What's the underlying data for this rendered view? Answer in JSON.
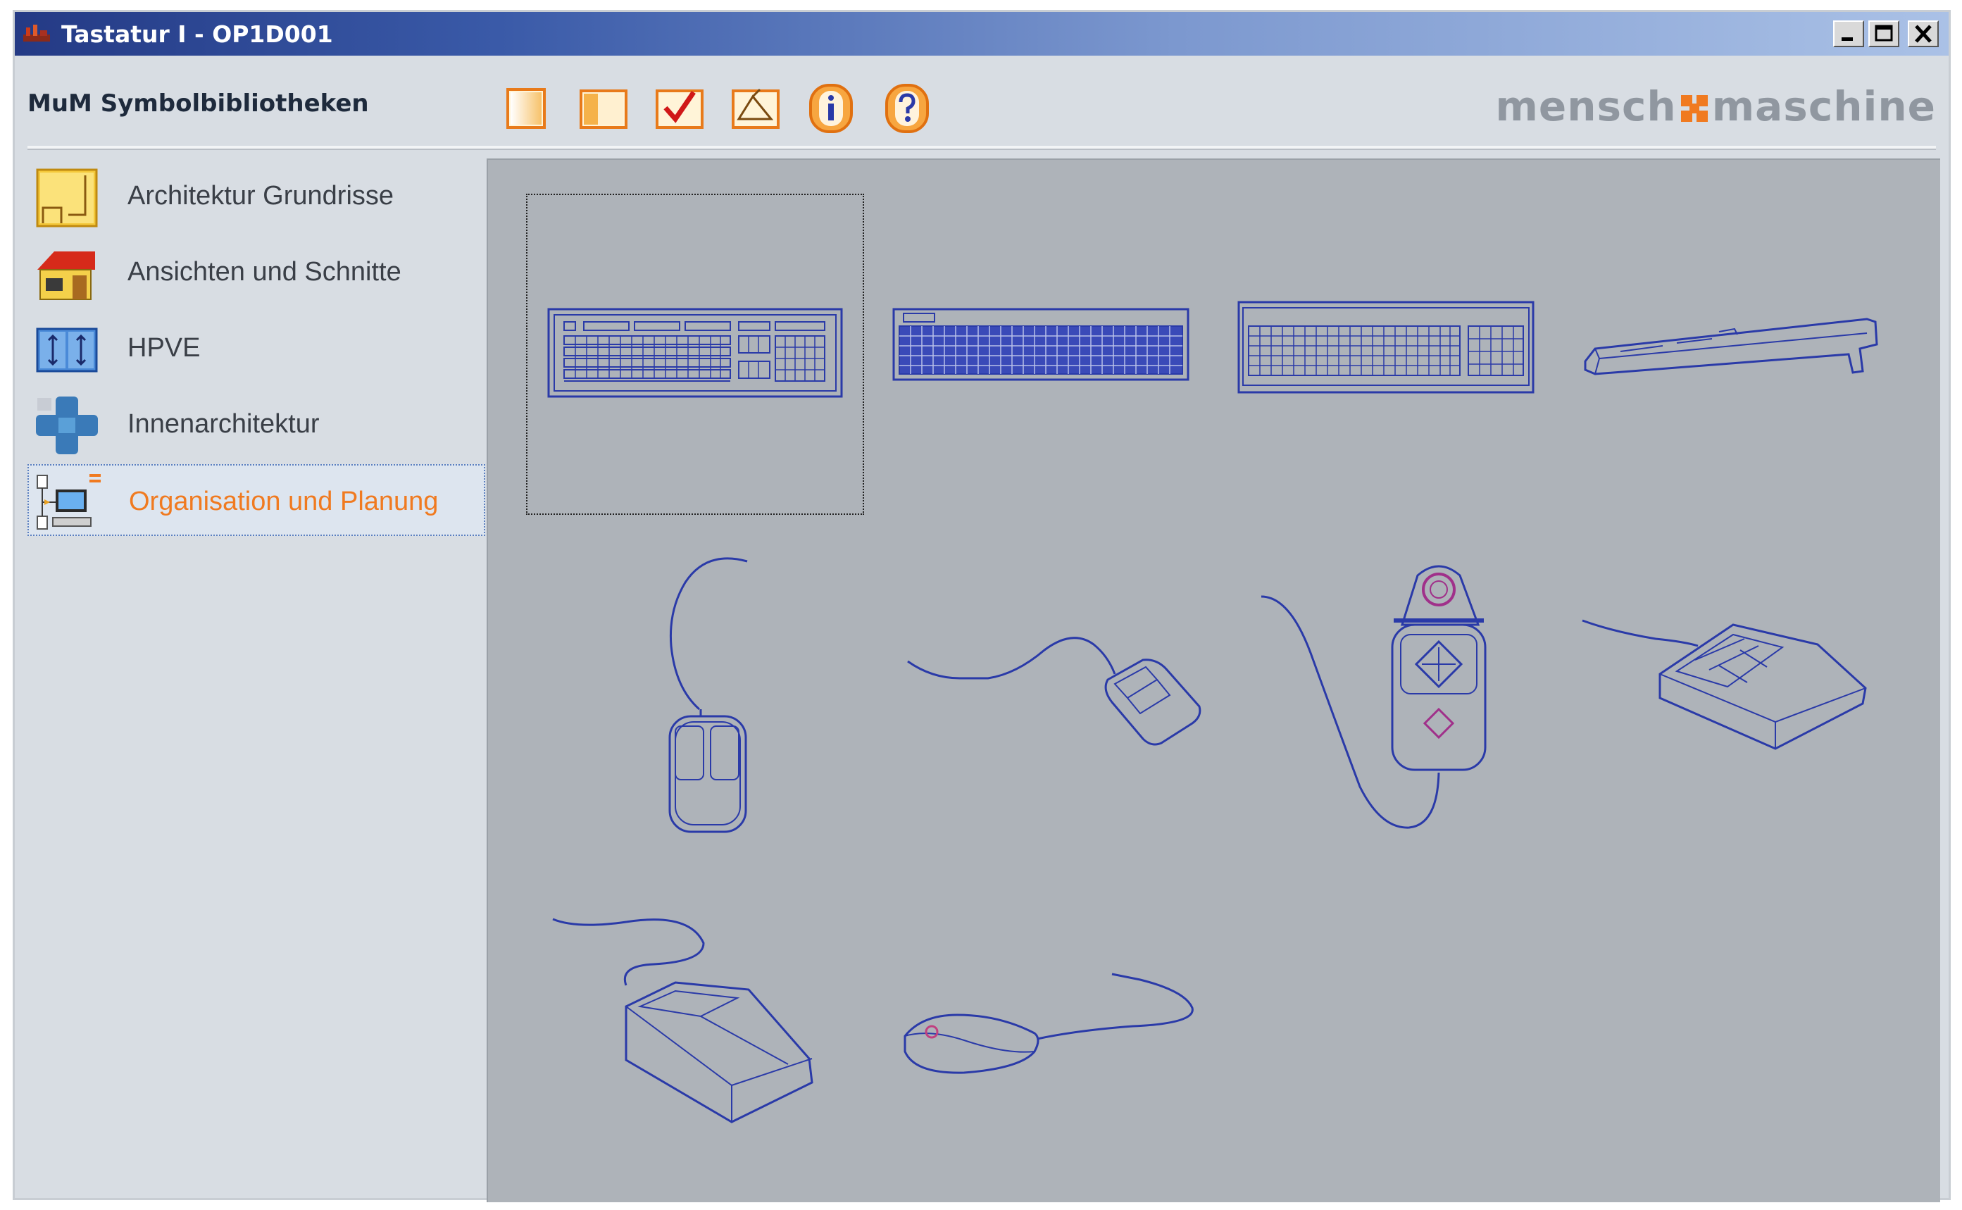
{
  "window": {
    "title": "Tastatur I - OP1D001"
  },
  "toolbar": {
    "label": "MuM Symbolbibliotheken",
    "buttons": [
      "new-icon",
      "panel-icon",
      "check-icon",
      "drawing-icon",
      "info-icon",
      "help-icon"
    ]
  },
  "logo": {
    "left": "mensch",
    "right": "maschine",
    "accent_color": "#f07a20"
  },
  "sidebar": {
    "items": [
      {
        "label": "Architektur Grundrisse",
        "icon": "floorplan-icon"
      },
      {
        "label": "Ansichten und Schnitte",
        "icon": "house-icon"
      },
      {
        "label": "HPVE",
        "icon": "hpve-icon"
      },
      {
        "label": "Innenarchitektur",
        "icon": "interior-icon"
      },
      {
        "label": "Organisation und Planung",
        "icon": "computer-icon",
        "selected": true
      }
    ]
  },
  "symbols": {
    "items": [
      "keyboard-1",
      "keyboard-2",
      "keyboard-3",
      "keyboard-4",
      "mouse-1",
      "mouse-2",
      "mouse-3",
      "mouse-4",
      "mouse-5",
      "mouse-6"
    ],
    "selected_index": 0,
    "stroke_color": "#2a3aa8"
  }
}
